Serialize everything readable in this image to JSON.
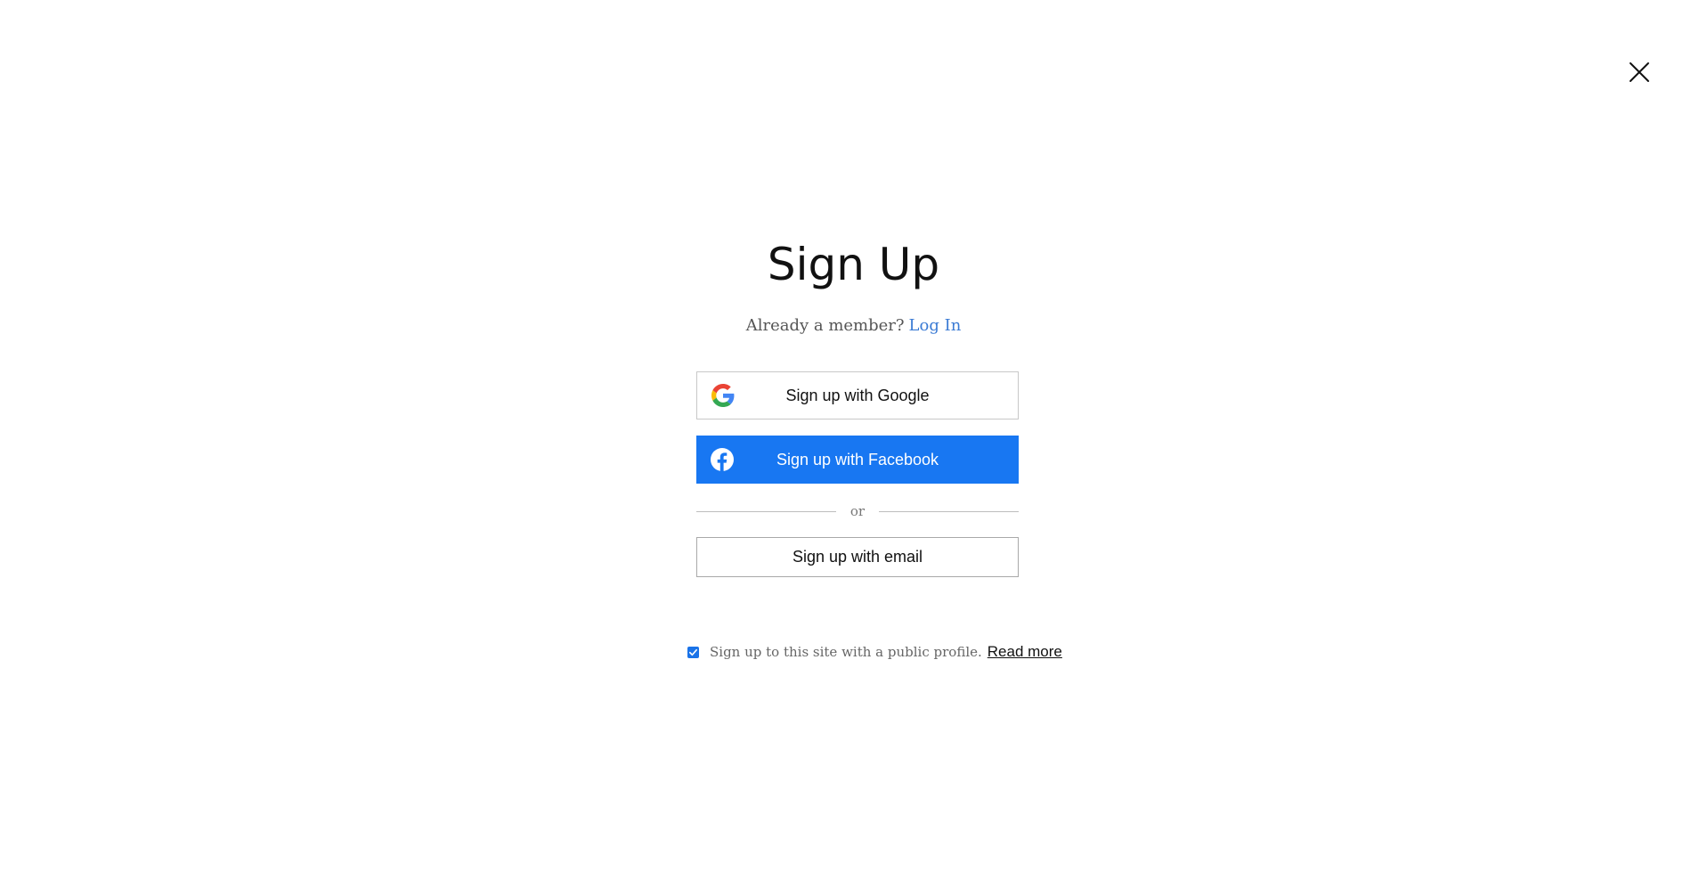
{
  "header": {
    "title": "Sign Up",
    "already_member": "Already a member?",
    "login_link": "Log In"
  },
  "buttons": {
    "google": "Sign up with Google",
    "facebook": "Sign up with Facebook",
    "email": "Sign up with email"
  },
  "divider": {
    "text": "or"
  },
  "profile": {
    "checked": true,
    "text": "Sign up to this site with a public profile.",
    "read_more": "Read more"
  },
  "icons": {
    "close": "close-icon",
    "google": "google-logo-icon",
    "facebook": "facebook-logo-icon",
    "checkbox": "checkmark-icon"
  },
  "colors": {
    "facebook_blue": "#1877f2",
    "link_blue": "#3b7bd4",
    "checkbox_blue": "#1a73e8"
  }
}
